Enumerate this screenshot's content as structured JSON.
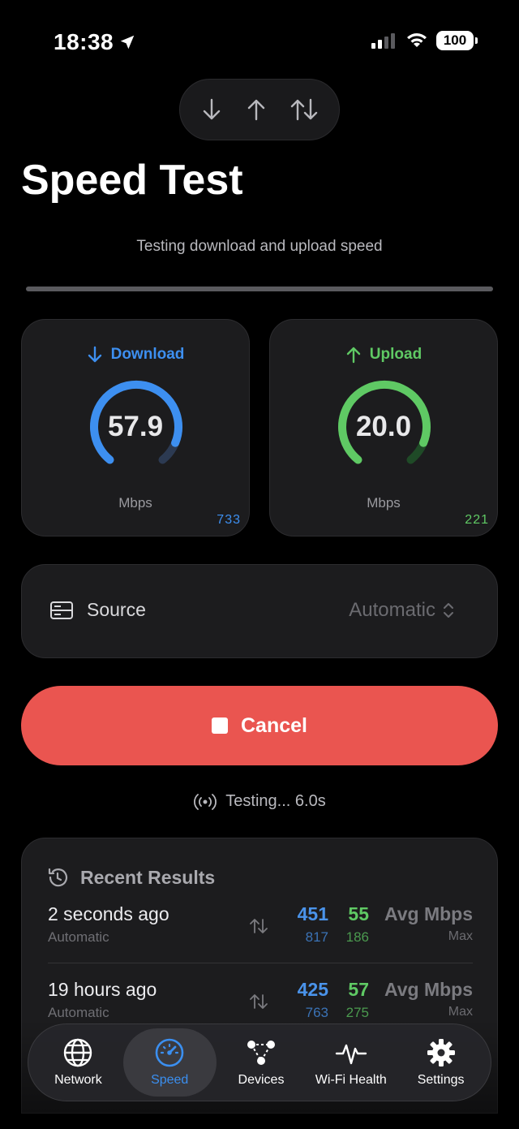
{
  "status_bar": {
    "time": "18:38",
    "battery": "100"
  },
  "direction_toggle": {
    "icons": [
      "arrow-down-icon",
      "arrow-up-icon",
      "arrows-up-down-icon"
    ]
  },
  "header": {
    "title": "Speed Test",
    "subtitle": "Testing download and upload speed"
  },
  "download": {
    "label": "Download",
    "value": "57.9",
    "unit": "Mbps",
    "peak": "733",
    "color": "#3d8ff0"
  },
  "upload": {
    "label": "Upload",
    "value": "20.0",
    "unit": "Mbps",
    "peak": "221",
    "color": "#5fc964"
  },
  "source": {
    "label": "Source",
    "value": "Automatic"
  },
  "cancel_button": {
    "label": "Cancel"
  },
  "testing_status": "Testing... 6.0s",
  "recent_results": {
    "title": "Recent Results",
    "rows": [
      {
        "when": "2 seconds ago",
        "source": "Automatic",
        "avg_dl": "451",
        "avg_ul": "55",
        "avg_label": "Avg Mbps",
        "max_dl": "817",
        "max_ul": "186",
        "max_label": "Max"
      },
      {
        "when": "19 hours ago",
        "source": "Automatic",
        "avg_dl": "425",
        "avg_ul": "57",
        "avg_label": "Avg Mbps",
        "max_dl": "763",
        "max_ul": "275",
        "max_label": "Max"
      }
    ]
  },
  "tabbar": {
    "items": [
      {
        "label": "Network",
        "icon": "globe-icon"
      },
      {
        "label": "Speed",
        "icon": "speedometer-icon",
        "active": true
      },
      {
        "label": "Devices",
        "icon": "devices-icon"
      },
      {
        "label": "Wi-Fi Health",
        "icon": "waveform-icon"
      },
      {
        "label": "Settings",
        "icon": "gear-icon"
      }
    ]
  }
}
